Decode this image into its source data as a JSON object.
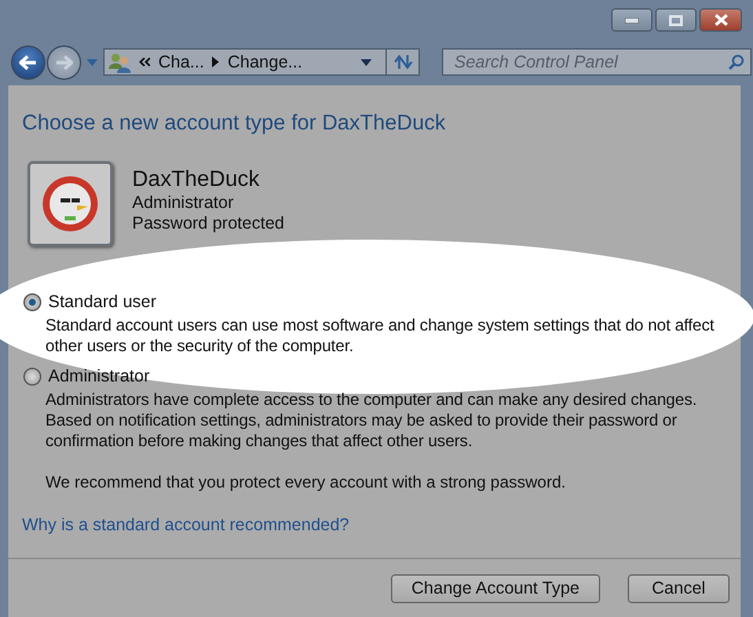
{
  "navigation": {
    "breadcrumb": [
      "Cha...",
      "Change..."
    ],
    "search": {
      "placeholder": "Search Control Panel"
    }
  },
  "heading": "Choose a new account type for DaxTheDuck",
  "account": {
    "name": "DaxTheDuck",
    "type": "Administrator",
    "status": "Password protected"
  },
  "options": [
    {
      "label": "Standard user",
      "description": "Standard account users can use most software and change system settings that do not affect other users or the security of the computer.",
      "selected": true,
      "highlighted": true
    },
    {
      "label": "Administrator",
      "description": "Administrators have complete access to the computer and can make any desired changes. Based on notification settings, administrators may be asked to provide their password or confirmation before making changes that affect other users.",
      "selected": false,
      "highlighted": false
    }
  ],
  "note": "We recommend that you protect every account with a strong password.",
  "link": "Why is a standard account recommended?",
  "buttons": [
    "Change Account Type",
    "Cancel"
  ]
}
